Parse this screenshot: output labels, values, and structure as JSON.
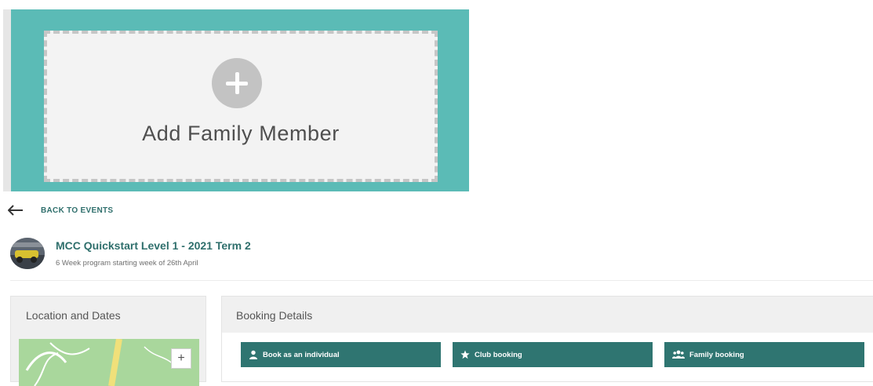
{
  "add_card": {
    "label": "Add Family Member"
  },
  "back": {
    "label": "BACK TO EVENTS"
  },
  "event": {
    "title": "MCC Quickstart Level 1 - 2021 Term 2",
    "subtitle": "6 Week program starting week of 26th April"
  },
  "location": {
    "title": "Location and Dates",
    "zoom_in": "+"
  },
  "booking": {
    "title": "Booking Details",
    "buttons": [
      {
        "label": "Book as an individual",
        "icon": "person-icon"
      },
      {
        "label": "Club booking",
        "icon": "star-icon"
      },
      {
        "label": "Family booking",
        "icon": "group-icon"
      }
    ]
  },
  "colors": {
    "teal_bg": "#5bbbb6",
    "accent_text": "#2f6f6c",
    "button_bg": "#2f7571"
  }
}
